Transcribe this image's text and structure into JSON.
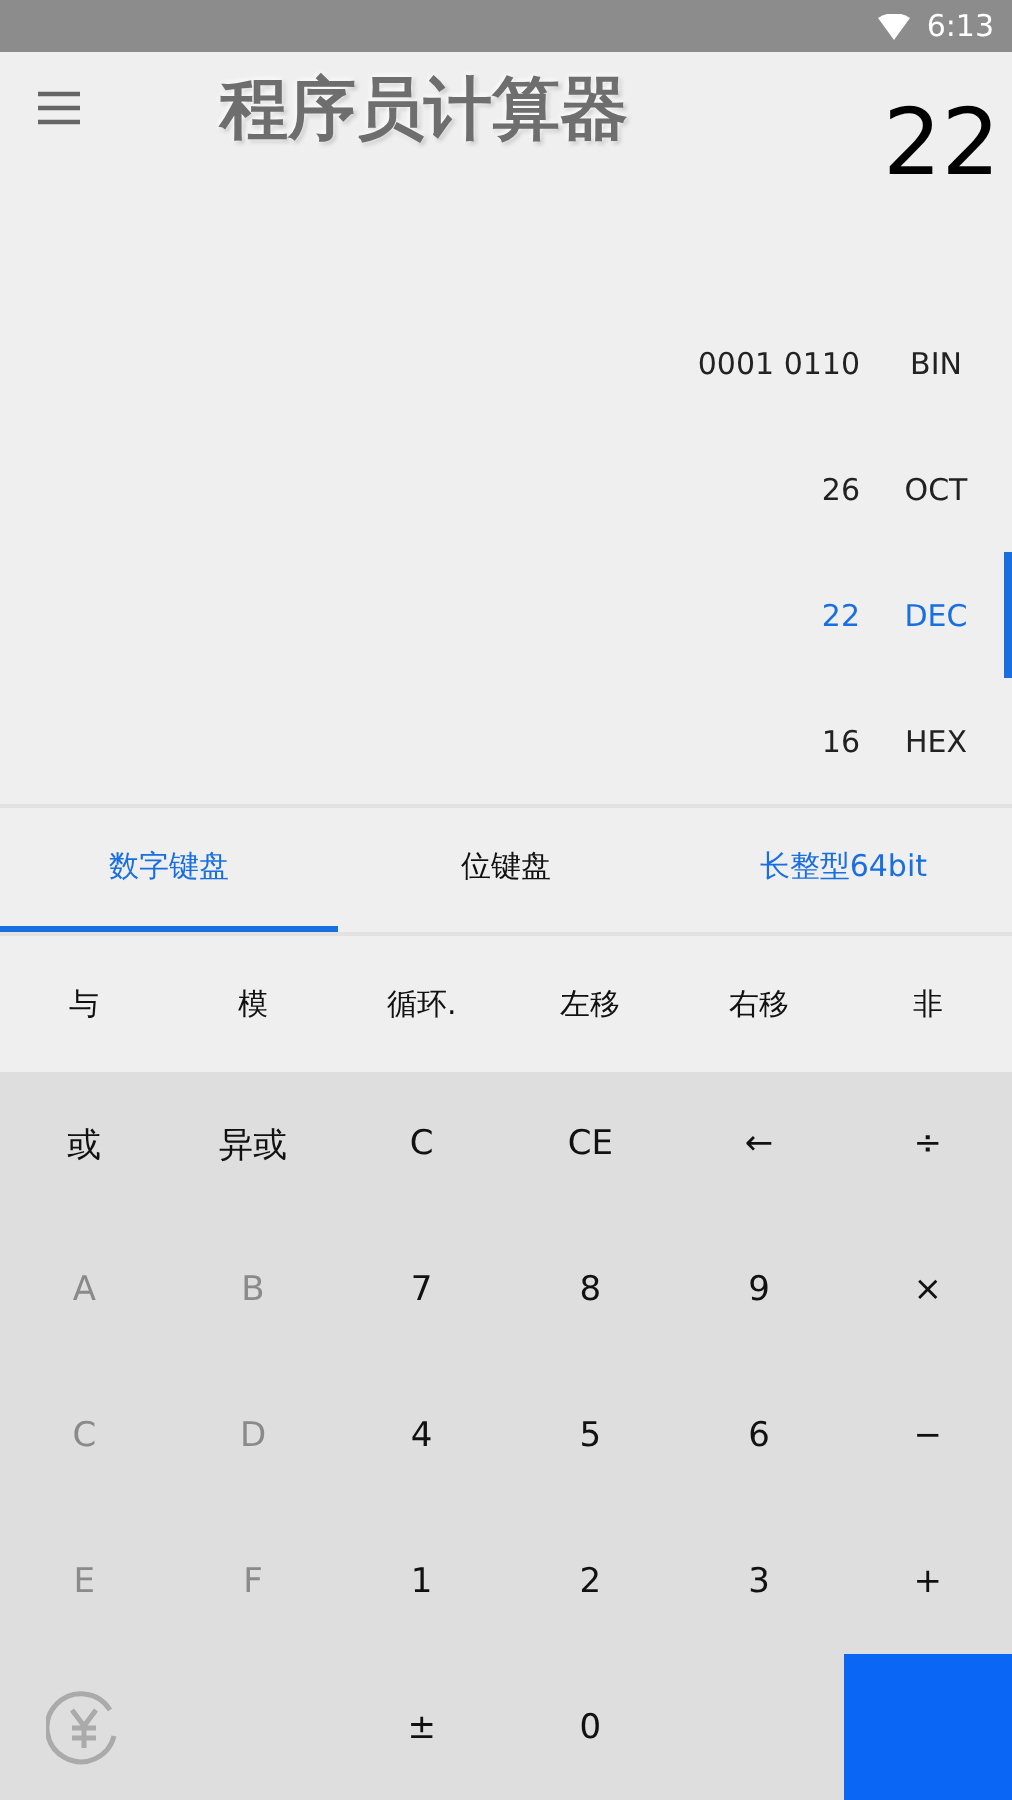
{
  "status_bar": {
    "time": "6:13"
  },
  "title": "程序员计算器",
  "display": "22",
  "bases": [
    {
      "value": "0001 0110",
      "name": "BIN",
      "selected": false
    },
    {
      "value": "26",
      "name": "OCT",
      "selected": false
    },
    {
      "value": "22",
      "name": "DEC",
      "selected": true
    },
    {
      "value": "16",
      "name": "HEX",
      "selected": false
    }
  ],
  "tabs": [
    {
      "label": "数字键盘",
      "kind": "tab",
      "selected": true
    },
    {
      "label": "位键盘",
      "kind": "tab",
      "selected": false
    },
    {
      "label": "长整型64bit",
      "kind": "mode",
      "selected": false
    }
  ],
  "operators": [
    "与",
    "模",
    "循环.",
    "左移",
    "右移",
    "非"
  ],
  "keys": [
    {
      "kind": "key",
      "label": "或",
      "disabled": false
    },
    {
      "kind": "key",
      "label": "异或",
      "disabled": false
    },
    {
      "kind": "key",
      "label": "C",
      "disabled": false
    },
    {
      "kind": "key",
      "label": "CE",
      "disabled": false
    },
    {
      "kind": "key",
      "label": "←",
      "disabled": false
    },
    {
      "kind": "key",
      "label": "÷",
      "disabled": false
    },
    {
      "kind": "key",
      "label": "A",
      "disabled": true
    },
    {
      "kind": "key",
      "label": "B",
      "disabled": true
    },
    {
      "kind": "key",
      "label": "7",
      "disabled": false
    },
    {
      "kind": "key",
      "label": "8",
      "disabled": false
    },
    {
      "kind": "key",
      "label": "9",
      "disabled": false
    },
    {
      "kind": "key",
      "label": "×",
      "disabled": false
    },
    {
      "kind": "key",
      "label": "C",
      "disabled": true
    },
    {
      "kind": "key",
      "label": "D",
      "disabled": true
    },
    {
      "kind": "key",
      "label": "4",
      "disabled": false
    },
    {
      "kind": "key",
      "label": "5",
      "disabled": false
    },
    {
      "kind": "key",
      "label": "6",
      "disabled": false
    },
    {
      "kind": "key",
      "label": "−",
      "disabled": false
    },
    {
      "kind": "key",
      "label": "E",
      "disabled": true
    },
    {
      "kind": "key",
      "label": "F",
      "disabled": true
    },
    {
      "kind": "key",
      "label": "1",
      "disabled": false
    },
    {
      "kind": "key",
      "label": "2",
      "disabled": false
    },
    {
      "kind": "key",
      "label": "3",
      "disabled": false
    },
    {
      "kind": "key",
      "label": "+",
      "disabled": false
    },
    {
      "kind": "currency"
    },
    {
      "kind": "blank"
    },
    {
      "kind": "key",
      "label": "±",
      "disabled": false
    },
    {
      "kind": "key",
      "label": "0",
      "disabled": false
    },
    {
      "kind": "blank"
    },
    {
      "kind": "equals"
    }
  ]
}
